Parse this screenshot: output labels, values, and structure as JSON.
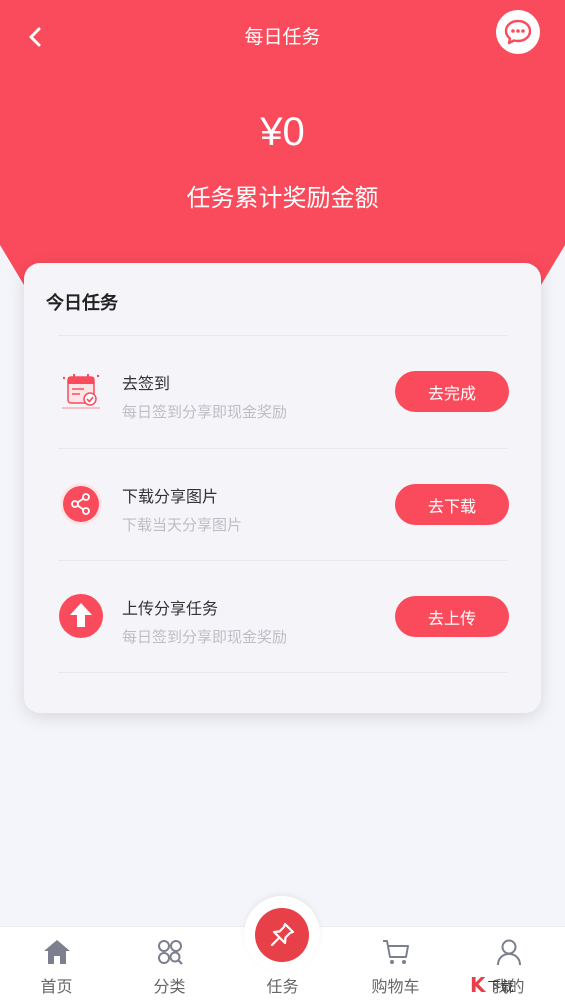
{
  "header": {
    "title": "每日任务",
    "amount": "¥0",
    "amount_label": "任务累计奖励金额",
    "accent": "#fa4b5c"
  },
  "card": {
    "title": "今日任务",
    "tasks": [
      {
        "name": "去签到",
        "desc": "每日签到分享即现金奖励",
        "button": "去完成",
        "icon": "calendar-check-icon"
      },
      {
        "name": "下载分享图片",
        "desc": "下载当天分享图片",
        "button": "去下载",
        "icon": "share-icon"
      },
      {
        "name": "上传分享任务",
        "desc": "每日签到分享即现金奖励",
        "button": "去上传",
        "icon": "upload-arrow-icon"
      }
    ]
  },
  "tabbar": {
    "items": [
      {
        "label": "首页",
        "icon": "home-icon"
      },
      {
        "label": "分类",
        "icon": "category-icon"
      },
      {
        "label": "任务",
        "icon": "pin-icon"
      },
      {
        "label": "购物车",
        "icon": "cart-icon"
      },
      {
        "label": "我的",
        "icon": "user-icon"
      }
    ]
  },
  "watermark": {
    "text": "下载"
  }
}
